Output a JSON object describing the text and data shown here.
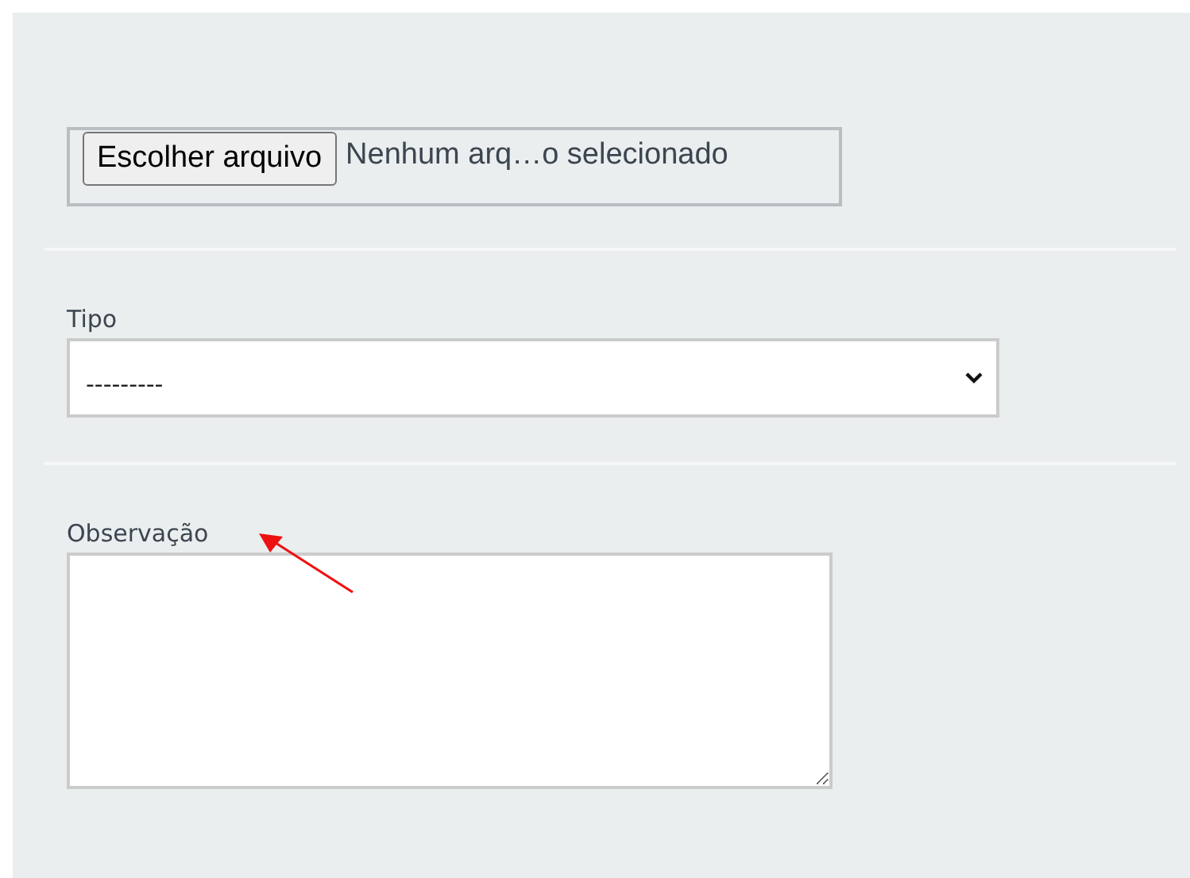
{
  "file_input": {
    "button": "Escolher arquivo",
    "status": "Nenhum arq…o selecionado"
  },
  "tipo": {
    "label": "Tipo",
    "value": "---------"
  },
  "observacao": {
    "label": "Observação"
  }
}
